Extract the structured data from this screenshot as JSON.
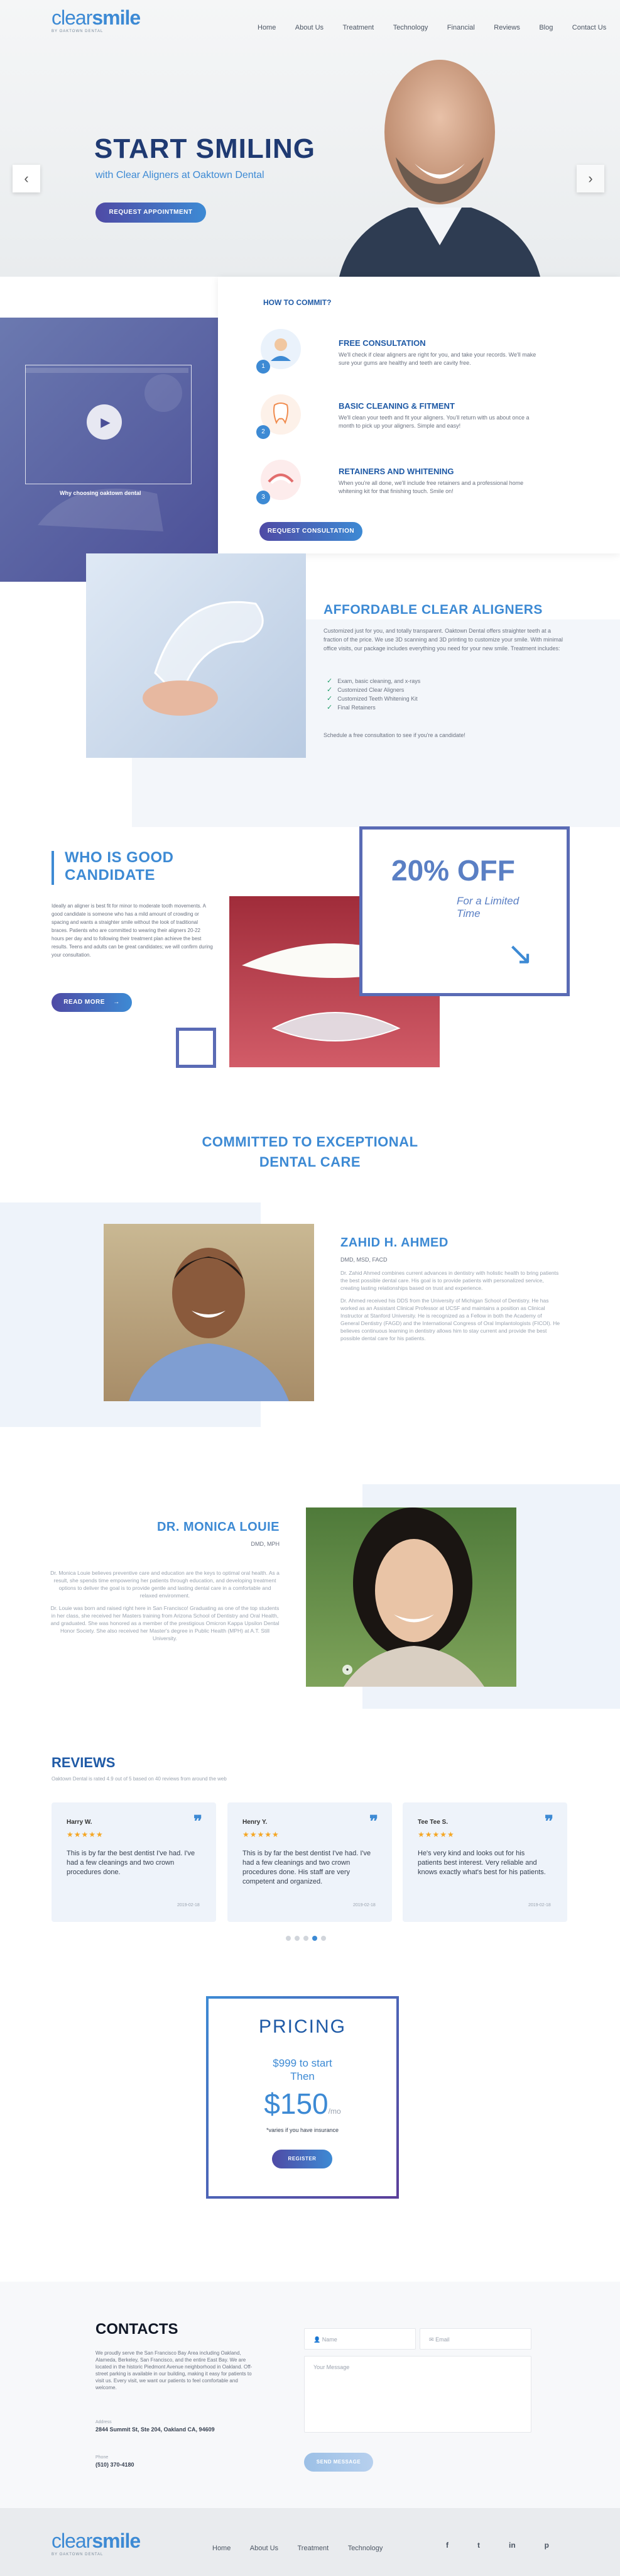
{
  "logo": {
    "prefix": "clear",
    "suffix": "smile",
    "tagline": "BY OAKTOWN DENTAL"
  },
  "nav": {
    "items": [
      "Home",
      "About Us",
      "Treatment",
      "Technology",
      "Financial",
      "Reviews",
      "Blog",
      "Contact Us"
    ]
  },
  "hero": {
    "title": "START SMILING",
    "subtitle": "with Clear Aligners at Oaktown Dental",
    "cta": "REQUEST APPOINTMENT",
    "prev_icon": "chevron-left-icon",
    "next_icon": "chevron-right-icon"
  },
  "video": {
    "caption": "Why choosing oaktown dental"
  },
  "how": {
    "heading": "HOW TO COMMIT?",
    "steps": [
      {
        "num": "1",
        "title": "FREE CONSULTATION",
        "text": "We'll check if clear aligners are right for you, and take your records. We'll make sure your gums are healthy and teeth are cavity free."
      },
      {
        "num": "2",
        "title": "BASIC CLEANING & FITMENT",
        "text": "We'll clean your teeth and fit your aligners. You'll return with us about once a month to pick up your aligners. Simple and easy!"
      },
      {
        "num": "3",
        "title": "RETAINERS AND WHITENING",
        "text": "When you're all done, we'll include free retainers and a professional home whitening kit for that finishing touch. Smile on!"
      }
    ],
    "cta": "REQUEST CONSULTATION"
  },
  "aligners": {
    "title": "AFFORDABLE CLEAR ALIGNERS",
    "text": "Customized just for you, and totally transparent. Oaktown Dental offers straighter teeth at a fraction of the price. We use 3D scanning and 3D printing to customize your smile. With minimal office visits, our package includes everything you need for your new smile. Treatment includes:",
    "items": [
      "Exam, basic cleaning, and x-rays",
      "Customized Clear Aligners",
      "Customized Teeth Whitening Kit",
      "Final Retainers"
    ],
    "footer": "Schedule a free consultation to see if you're a candidate!"
  },
  "candidate": {
    "title_line1": "WHO IS GOOD",
    "title_line2": "CANDIDATE",
    "text": "Ideally an aligner is best fit for minor to moderate tooth movements. A good candidate is someone who has a mild amount of crowding or spacing and wants a straighter smile without the look of traditional braces. Patients who are committed to wearing their aligners 20-22 hours per day and to following their treatment plan achieve the best results. Teens and adults can be great candidates; we will confirm during your consultation.",
    "cta": "READ MORE"
  },
  "offer": {
    "big": "20% OFF",
    "line1": "For a Limited",
    "line2": "Time"
  },
  "committed": {
    "line1": "COMMITTED TO EXCEPTIONAL",
    "line2": "DENTAL CARE"
  },
  "doctor1": {
    "name": "ZAHID H. AHMED",
    "creds": "DMD, MSD, FACD",
    "p1": "Dr. Zahid Ahmed combines current advances in dentistry with holistic health to bring patients the best possible dental care. His goal is to provide patients with personalized service, creating lasting relationships based on trust and experience.",
    "p2": "Dr. Ahmed received his DDS from the University of Michigan School of Dentistry. He has worked as an Assistant Clinical Professor at UCSF and maintains a position as Clinical Instructor at Stanford University. He is recognized as a Fellow in both the Academy of General Dentistry (FAGD) and the International Congress of Oral Implantologists (FICOI). He believes continuous learning in dentistry allows him to stay current and provide the best possible dental care for his patients."
  },
  "doctor2": {
    "name": "DR. MONICA LOUIE",
    "creds": "DMD, MPH",
    "p1": "Dr. Monica Louie believes preventive care and education are the keys to optimal oral health. As a result, she spends time empowering her patients through education, and developing treatment options to deliver the goal is to provide gentle and lasting dental care in a comfortable and relaxed environment.",
    "p2": "Dr. Louie was born and raised right here in San Francisco! Graduating as one of the top students in her class, she received her Masters training from Arizona School of Dentistry and Oral Health, and graduated. She was honored as a member of the prestigious Omicron Kappa Upsilon Dental Honor Society. She also received her Master's degree in Public Health (MPH) at A.T. Still University."
  },
  "reviews": {
    "title": "REVIEWS",
    "subtitle": "Oaktown Dental is rated 4.9 out of 5 based on 40 reviews from around the web",
    "cards": [
      {
        "name": "Harry W.",
        "stars": "★★★★★",
        "text": "This is by far the best dentist I've had. I've had a few cleanings and two crown procedures done.",
        "date": "2019-02-18"
      },
      {
        "name": "Henry Y.",
        "stars": "★★★★★",
        "text": "This is by far the best dentist I've had. I've had a few cleanings and two crown procedures done. His staff are very competent and organized.",
        "date": "2019-02-18"
      },
      {
        "name": "Tee Tee S.",
        "stars": "★★★★★",
        "text": "He's very kind and looks out for his patients best interest. Very reliable and knows exactly what's best for his patients.",
        "date": "2019-02-18"
      }
    ]
  },
  "pricing": {
    "title": "PRICING",
    "line1": "$999 to start",
    "line2": "Then",
    "amount": "$150",
    "per": "/mo",
    "note": "*varies if you have insurance",
    "cta": "REGISTER"
  },
  "contacts": {
    "title": "CONTACTS",
    "text": "We proudly serve the San Francisco Bay Area including Oakland, Alameda, Berkeley, San Francisco, and the entire East Bay. We are located in the historic Piedmont Avenue neighborhood in Oakland. Off-street parking is available in our building, making it easy for patients to visit us. Every visit, we want our patients to feel comfortable and welcome.",
    "addr_label": "Address",
    "address": "2844 Summit St, Ste 204, Oakland CA, 94609",
    "phone_label": "Phone",
    "phone": "(510) 370-4180",
    "name_ph": "Name",
    "email_ph": "Email",
    "msg_ph": "Your Message",
    "send": "SEND MESSAGE"
  },
  "footer": {
    "links": [
      "Home",
      "About Us",
      "Treatment",
      "Technology"
    ],
    "social": [
      "f",
      "t",
      "in",
      "p"
    ]
  }
}
